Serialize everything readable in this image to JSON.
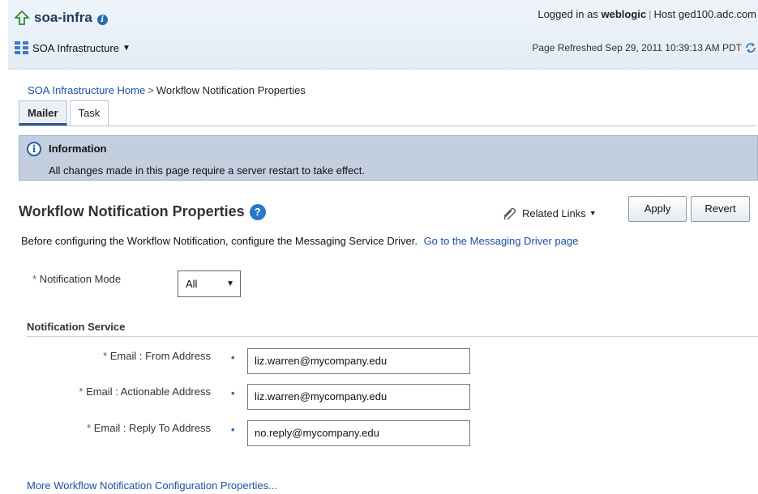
{
  "header": {
    "app_name": "soa-infra",
    "target_menu_label": "SOA Infrastructure",
    "logged_in_prefix": "Logged in as",
    "username": "weblogic",
    "host_label": "Host",
    "host_name": "ged100.adc.com",
    "page_refreshed": "Page Refreshed Sep 29, 2011 10:39:13 AM PDT"
  },
  "breadcrumb": {
    "home": "SOA Infrastructure Home",
    "separator": ">",
    "current": "Workflow Notification Properties"
  },
  "tabs": [
    {
      "label": "Mailer",
      "active": true
    },
    {
      "label": "Task",
      "active": false
    }
  ],
  "info": {
    "title": "Information",
    "message": "All changes made in this page require a server restart to take effect."
  },
  "section": {
    "title": "Workflow Notification Properties",
    "related_links": "Related Links",
    "apply_label": "Apply",
    "revert_label": "Revert",
    "intro_text": "Before configuring the Workflow Notification, configure the Messaging Service Driver.",
    "intro_link": "Go to the Messaging Driver page"
  },
  "mode": {
    "label": "Notification Mode",
    "selected": "All"
  },
  "service": {
    "title": "Notification Service",
    "fields": [
      {
        "label": "Email : From Address",
        "value": "liz.warren@mycompany.edu"
      },
      {
        "label": "Email : Actionable Address",
        "value": "liz.warren@mycompany.edu"
      },
      {
        "label": "Email : Reply To Address",
        "value": "no.reply@mycompany.edu"
      }
    ]
  },
  "more_link": "More Workflow Notification Configuration Properties...",
  "colors": {
    "link": "#1e4fa0",
    "info_bg": "#c3cfdf",
    "header_bg": "#e3ecf5"
  },
  "icons": {
    "app": "up-arrow-icon",
    "target": "tree-icon",
    "refresh": "refresh-icon",
    "info": "info-icon",
    "help": "help-icon",
    "related": "paperclip-icon"
  }
}
